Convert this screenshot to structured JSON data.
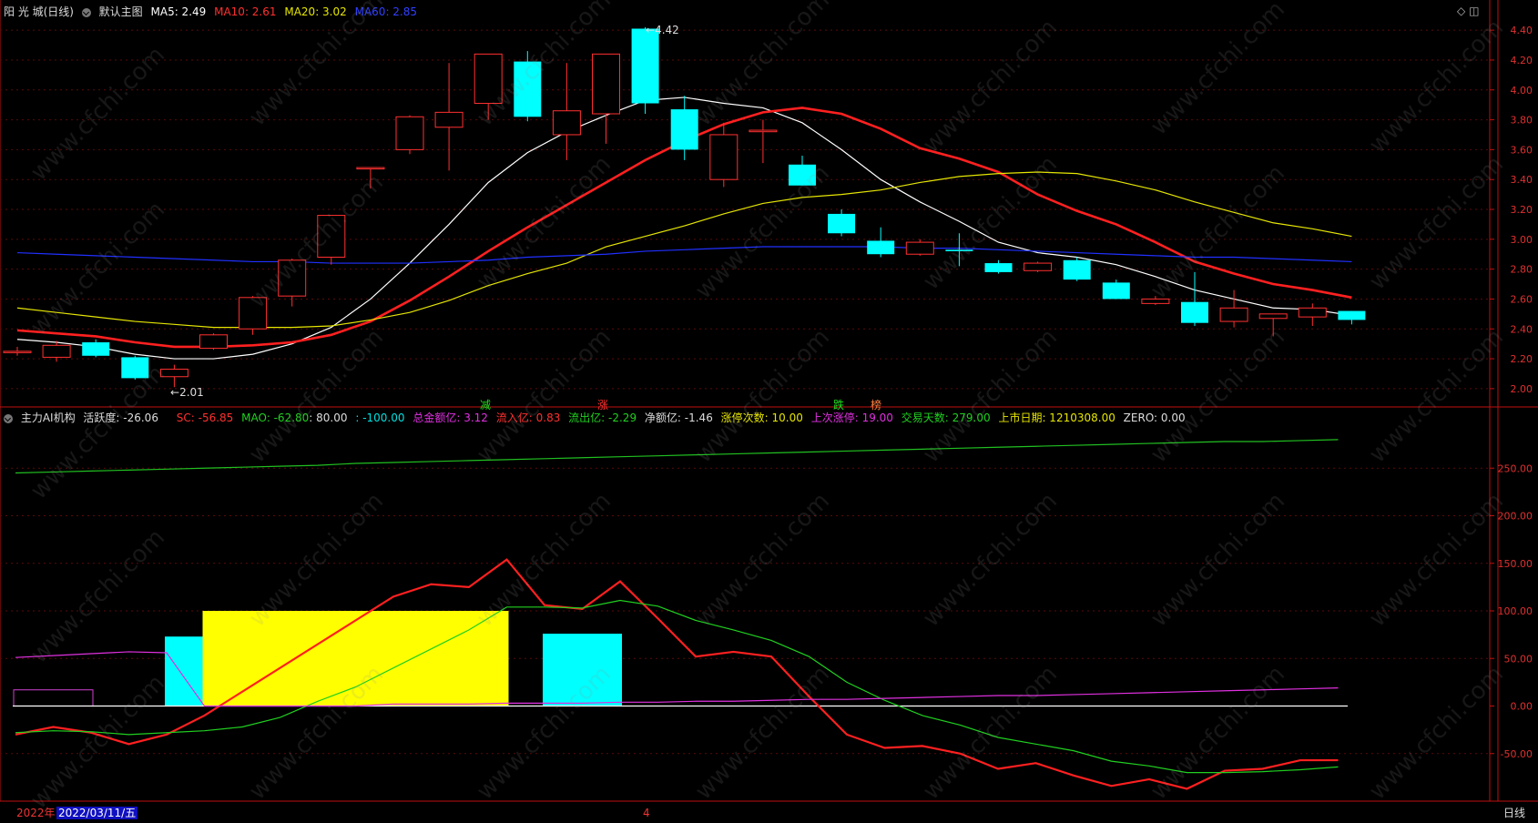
{
  "header_main": {
    "stock_name": "阳 光 城(日线)",
    "main_chart_label": "默认主图",
    "ma5": "MA5: 2.49",
    "ma10": "MA10: 2.61",
    "ma20": "MA20: 3.02",
    "ma60": "MA60: 2.85",
    "colors": {
      "ma5": "#ffffff",
      "ma10": "#ff2020",
      "ma20": "#e6e600",
      "ma60": "#2030ff"
    }
  },
  "header_sub": {
    "indicator_name": "主力AI机构",
    "activity": "活跃度: -26.06",
    "sc": "SC: -56.85",
    "mao": "MAO: -62.80",
    "levels": ": 80.00",
    "levels2": ": -100.00",
    "total": "总金额亿: 3.12",
    "inflow": "流入亿: 0.83",
    "outflow": "流出亿: -2.29",
    "net": "净额亿: -1.46",
    "limit_up": "涨停次数: 10.00",
    "last_limit": "上次涨停: 19.00",
    "trade_days": "交易天数: 279.00",
    "listing": "上市日期: 1210308.00",
    "zero": "ZERO: 0.00"
  },
  "markers": [
    {
      "text": "减",
      "color": "#20e020"
    },
    {
      "text": "涨",
      "color": "#ff3030"
    },
    {
      "text": "跌",
      "color": "#20e020"
    },
    {
      "text": "榜",
      "color": "#ff8040"
    }
  ],
  "annotations": {
    "high": "4.42",
    "low": "2.01"
  },
  "bottom_bar": {
    "year": "2022年",
    "date": "2022/03/11/五",
    "month": "4",
    "period": "日线"
  },
  "watermark": "www.cfchi.com",
  "chart_data": [
    {
      "type": "candlestick",
      "title": "阳 光 城(日线)",
      "ylim": [
        1.92,
        4.48
      ],
      "yticks": [
        2.0,
        2.2,
        2.4,
        2.6,
        2.8,
        3.0,
        3.2,
        3.4,
        3.6,
        3.8,
        4.0,
        4.2,
        4.4
      ],
      "candles": [
        {
          "o": 2.25,
          "h": 2.28,
          "l": 2.22,
          "c": 2.25
        },
        {
          "o": 2.21,
          "h": 2.32,
          "l": 2.18,
          "c": 2.29
        },
        {
          "o": 2.31,
          "h": 2.33,
          "l": 2.21,
          "c": 2.22
        },
        {
          "o": 2.21,
          "h": 2.22,
          "l": 2.06,
          "c": 2.07
        },
        {
          "o": 2.08,
          "h": 2.16,
          "l": 2.01,
          "c": 2.13
        },
        {
          "o": 2.27,
          "h": 2.37,
          "l": 2.26,
          "c": 2.36
        },
        {
          "o": 2.4,
          "h": 2.62,
          "l": 2.36,
          "c": 2.61
        },
        {
          "o": 2.62,
          "h": 2.87,
          "l": 2.55,
          "c": 2.86
        },
        {
          "o": 2.88,
          "h": 3.16,
          "l": 2.83,
          "c": 3.16
        },
        {
          "o": 3.48,
          "h": 3.48,
          "l": 3.34,
          "c": 3.48
        },
        {
          "o": 3.6,
          "h": 3.83,
          "l": 3.57,
          "c": 3.82
        },
        {
          "o": 3.75,
          "h": 4.18,
          "l": 3.46,
          "c": 3.85
        },
        {
          "o": 3.91,
          "h": 4.24,
          "l": 3.8,
          "c": 4.24
        },
        {
          "o": 4.19,
          "h": 4.26,
          "l": 3.79,
          "c": 3.82
        },
        {
          "o": 3.7,
          "h": 4.18,
          "l": 3.53,
          "c": 3.86
        },
        {
          "o": 3.84,
          "h": 4.24,
          "l": 3.64,
          "c": 4.24
        },
        {
          "o": 4.41,
          "h": 4.42,
          "l": 3.84,
          "c": 3.91
        },
        {
          "o": 3.87,
          "h": 3.96,
          "l": 3.53,
          "c": 3.6
        },
        {
          "o": 3.4,
          "h": 3.78,
          "l": 3.35,
          "c": 3.7
        },
        {
          "o": 3.72,
          "h": 3.8,
          "l": 3.51,
          "c": 3.73
        },
        {
          "o": 3.5,
          "h": 3.56,
          "l": 3.36,
          "c": 3.36
        },
        {
          "o": 3.17,
          "h": 3.2,
          "l": 3.02,
          "c": 3.04
        },
        {
          "o": 2.99,
          "h": 3.08,
          "l": 2.88,
          "c": 2.9
        },
        {
          "o": 2.9,
          "h": 3.0,
          "l": 2.89,
          "c": 2.98
        },
        {
          "o": 2.93,
          "h": 3.04,
          "l": 2.82,
          "c": 2.92
        },
        {
          "o": 2.84,
          "h": 2.86,
          "l": 2.77,
          "c": 2.78
        },
        {
          "o": 2.79,
          "h": 2.85,
          "l": 2.78,
          "c": 2.84
        },
        {
          "o": 2.86,
          "h": 2.88,
          "l": 2.72,
          "c": 2.73
        },
        {
          "o": 2.71,
          "h": 2.73,
          "l": 2.6,
          "c": 2.6
        },
        {
          "o": 2.57,
          "h": 2.62,
          "l": 2.56,
          "c": 2.6
        },
        {
          "o": 2.58,
          "h": 2.78,
          "l": 2.42,
          "c": 2.44
        },
        {
          "o": 2.45,
          "h": 2.66,
          "l": 2.41,
          "c": 2.54
        },
        {
          "o": 2.47,
          "h": 2.5,
          "l": 2.35,
          "c": 2.5
        },
        {
          "o": 2.48,
          "h": 2.57,
          "l": 2.42,
          "c": 2.54
        },
        {
          "o": 2.52,
          "h": 2.52,
          "l": 2.43,
          "c": 2.46
        }
      ],
      "series": [
        {
          "name": "MA5",
          "values": [
            2.33,
            2.31,
            2.28,
            2.23,
            2.2,
            2.2,
            2.23,
            2.3,
            2.41,
            2.6,
            2.84,
            3.1,
            3.38,
            3.58,
            3.72,
            3.83,
            3.93,
            3.95,
            3.91,
            3.88,
            3.78,
            3.6,
            3.4,
            3.25,
            3.12,
            2.98,
            2.91,
            2.88,
            2.83,
            2.75,
            2.66,
            2.6,
            2.54,
            2.53,
            2.49
          ]
        },
        {
          "name": "MA10",
          "values": [
            2.39,
            2.37,
            2.35,
            2.31,
            2.28,
            2.28,
            2.29,
            2.31,
            2.36,
            2.45,
            2.59,
            2.75,
            2.92,
            3.08,
            3.23,
            3.38,
            3.53,
            3.66,
            3.77,
            3.85,
            3.88,
            3.84,
            3.74,
            3.61,
            3.54,
            3.45,
            3.3,
            3.19,
            3.1,
            2.98,
            2.85,
            2.77,
            2.7,
            2.66,
            2.61
          ]
        },
        {
          "name": "MA20",
          "values": [
            2.54,
            2.51,
            2.48,
            2.45,
            2.43,
            2.41,
            2.41,
            2.41,
            2.42,
            2.46,
            2.51,
            2.59,
            2.69,
            2.77,
            2.84,
            2.95,
            3.02,
            3.09,
            3.17,
            3.24,
            3.28,
            3.3,
            3.33,
            3.38,
            3.42,
            3.44,
            3.45,
            3.44,
            3.39,
            3.33,
            3.25,
            3.18,
            3.11,
            3.07,
            3.02
          ]
        },
        {
          "name": "MA60",
          "values": [
            2.91,
            2.9,
            2.89,
            2.88,
            2.87,
            2.86,
            2.85,
            2.85,
            2.84,
            2.84,
            2.84,
            2.85,
            2.86,
            2.88,
            2.89,
            2.9,
            2.92,
            2.93,
            2.94,
            2.95,
            2.95,
            2.95,
            2.95,
            2.94,
            2.94,
            2.93,
            2.92,
            2.91,
            2.9,
            2.89,
            2.88,
            2.88,
            2.87,
            2.86,
            2.85
          ]
        }
      ]
    },
    {
      "type": "line",
      "title": "主力AI机构",
      "ylim": [
        -100,
        300
      ],
      "yticks": [
        -50,
        0,
        50,
        100,
        150,
        200,
        250
      ],
      "ytick_labels": [
        "-50.00",
        "0.00",
        "50.00",
        "100.00",
        "150.00",
        "200.00",
        "250.00"
      ],
      "series": [
        {
          "name": "SC",
          "color": "#ff2020",
          "values": [
            -30,
            -22,
            -28,
            -40,
            -30,
            -10,
            15,
            40,
            65,
            90,
            115,
            128,
            125,
            154,
            106,
            102,
            131,
            92,
            52,
            57,
            52,
            10,
            -30,
            -44,
            -42,
            -50,
            -66,
            -60,
            -73,
            -84,
            -77,
            -87,
            -68,
            -66,
            -57,
            -57
          ]
        },
        {
          "name": "MAO",
          "color": "#20d020",
          "values": [
            -28,
            -26,
            -27,
            -30,
            -28,
            -26,
            -22,
            -12,
            5,
            20,
            40,
            60,
            80,
            104,
            104,
            103,
            111,
            105,
            90,
            80,
            69,
            52,
            25,
            6,
            -10,
            -20,
            -33,
            -40,
            -47,
            -58,
            -63,
            -70,
            -70,
            -69,
            -67,
            -64
          ]
        },
        {
          "name": "活跃度",
          "color": "#e030e0",
          "values": [
            51,
            53,
            55,
            57,
            56,
            0,
            0,
            0,
            0,
            0,
            2,
            2,
            2,
            3,
            3,
            3,
            4,
            4,
            5,
            5,
            6,
            7,
            7,
            8,
            9,
            10,
            11,
            11,
            12,
            13,
            14,
            15,
            16,
            17,
            18,
            19
          ]
        },
        {
          "name": "交易天数",
          "color": "#20c020",
          "values": [
            245,
            246,
            247,
            248,
            249,
            250,
            251,
            252,
            253,
            255,
            256,
            257,
            258,
            259,
            260,
            261,
            262,
            263,
            264,
            265,
            266,
            267,
            268,
            269,
            270,
            271,
            272,
            273,
            274,
            275,
            276,
            277,
            278,
            278,
            279,
            280
          ]
        }
      ],
      "bars": [
        {
          "x0": 0,
          "x1": 2,
          "v": 17,
          "color": "#d040d0",
          "outline": true
        },
        {
          "x0": 4,
          "x1": 5,
          "v": 73,
          "color": "#00ffff"
        },
        {
          "x0": 5,
          "x1": 13,
          "v": 100,
          "color": "#ffff00"
        },
        {
          "x0": 14,
          "x1": 16,
          "v": 76,
          "color": "#00ffff"
        }
      ]
    }
  ]
}
